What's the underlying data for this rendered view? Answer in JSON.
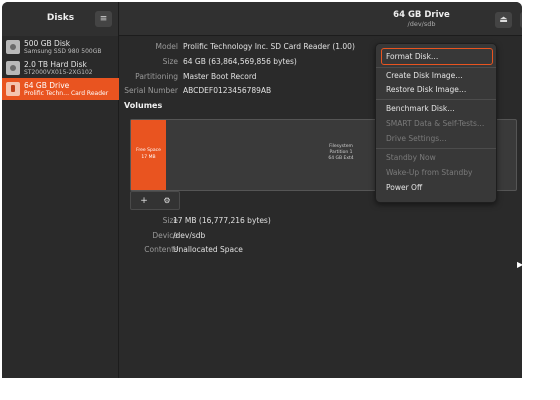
{
  "app": {
    "title": "Disks",
    "menu_icon": "hamburger-icon"
  },
  "window": {
    "title": "64 GB Drive",
    "subtitle": "/dev/sdb"
  },
  "header_buttons": {
    "eject_icon": "eject-icon",
    "power_icon": "power-icon",
    "more_icon": "vertical-dots-icon"
  },
  "sidebar": {
    "items": [
      {
        "name": "500 GB Disk",
        "sub": "Samsung SSD 980 500GB",
        "icon": "drive-icon",
        "selected": false
      },
      {
        "name": "2.0 TB Hard Disk",
        "sub": "ST2000VX015-2XG102",
        "icon": "drive-icon",
        "selected": false
      },
      {
        "name": "64 GB Drive",
        "sub": "Prolific Techn… Card Reader",
        "icon": "sd-card-icon",
        "selected": true
      }
    ]
  },
  "drive": {
    "model_label": "Model",
    "model": "Prolific Technology Inc. SD Card Reader (1.00)",
    "size_label": "Size",
    "size": "64 GB (63,864,569,856 bytes)",
    "partitioning_label": "Partitioning",
    "partitioning": "Master Boot Record",
    "serial_label": "Serial Number",
    "serial": "ABCDEF0123456789AB"
  },
  "volumes": {
    "heading": "Volumes",
    "free": {
      "line1": "Free Space",
      "line2": "17 MB"
    },
    "partition": {
      "line1": "Filesystem",
      "line2": "Partition 1",
      "line3": "64 GB Ext4"
    }
  },
  "selected_volume": {
    "size_label": "Size",
    "size": "17 MB (16,777,216 bytes)",
    "device_label": "Device",
    "device": "/dev/sdb",
    "contents_label": "Contents",
    "contents": "Unallocated Space"
  },
  "menu": {
    "items": [
      {
        "label": "Format Disk…",
        "enabled": true
      },
      {
        "label": "Create Disk Image…",
        "enabled": true
      },
      {
        "label": "Restore Disk Image…",
        "enabled": true
      },
      {
        "label": "Benchmark Disk…",
        "enabled": true
      },
      {
        "label": "SMART Data & Self-Tests…",
        "enabled": false
      },
      {
        "label": "Drive Settings…",
        "enabled": false
      },
      {
        "label": "Standby Now",
        "enabled": false
      },
      {
        "label": "Wake-Up from Standby",
        "enabled": false
      },
      {
        "label": "Power Off",
        "enabled": true
      }
    ]
  },
  "colors": {
    "accent": "#e95420",
    "background": "#2a2a2a",
    "header": "#303030"
  }
}
